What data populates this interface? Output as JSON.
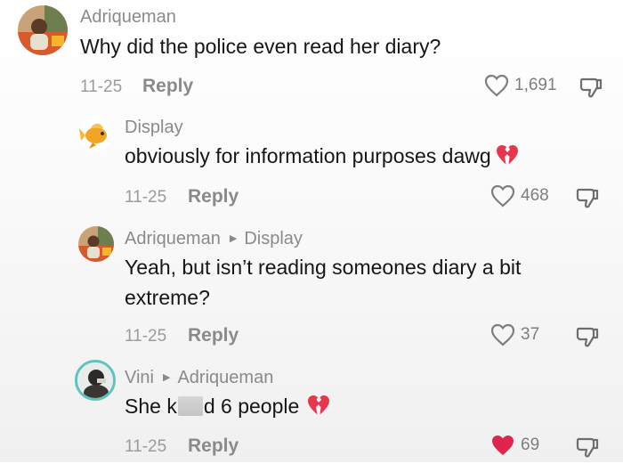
{
  "comments": [
    {
      "author": "Adriqueman",
      "reply_to": "",
      "text": "Why did the police even read her diary?",
      "date": "11-25",
      "reply_label": "Reply",
      "likes": "1,691",
      "liked": false,
      "avatar": "photo-avatar"
    },
    {
      "author": "Display",
      "reply_to": "",
      "text": "obviously for information purposes dawg",
      "emoji": "broken-heart-icon",
      "date": "11-25",
      "reply_label": "Reply",
      "likes": "468",
      "liked": false,
      "avatar": "goldfish-avatar"
    },
    {
      "author": "Adriqueman",
      "reply_to": "Display",
      "text_line1": "Yeah, but isn’t reading someones diary a bit",
      "text_line2": "extreme?",
      "date": "11-25",
      "reply_label": "Reply",
      "likes": "37",
      "liked": false,
      "avatar": "photo-avatar"
    },
    {
      "author": "Vini",
      "reply_to": "Adriqueman",
      "text_before": "She k",
      "text_after": "d 6 people",
      "emoji": "broken-heart-icon",
      "date": "11-25",
      "reply_label": "Reply",
      "likes": "69",
      "liked": true,
      "avatar": "ringed-avatar"
    }
  ],
  "colors": {
    "liked_heart": "#e0254c",
    "broken_heart": "#e8364f",
    "meta_gray": "#8a8a8a",
    "text": "#161616"
  }
}
